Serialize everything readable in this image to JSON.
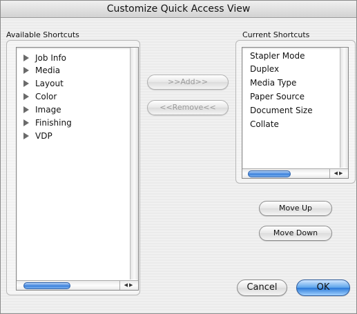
{
  "window": {
    "title": "Customize Quick Access View"
  },
  "available": {
    "label": "Available Shortcuts",
    "items": [
      "Job Info",
      "Media",
      "Layout",
      "Color",
      "Image",
      "Finishing",
      "VDP"
    ]
  },
  "current": {
    "label": "Current Shortcuts",
    "items": [
      "Stapler Mode",
      "Duplex",
      "Media Type",
      "Paper Source",
      "Document Size",
      "Collate"
    ]
  },
  "buttons": {
    "add": ">>Add>>",
    "remove": "<<Remove<<",
    "move_up": "Move Up",
    "move_down": "Move Down",
    "cancel": "Cancel",
    "ok": "OK"
  },
  "icons": {
    "expand": "disclosure-triangle-icon",
    "scroll_left": "scroll-left-arrow-icon",
    "scroll_right": "scroll-right-arrow-icon"
  }
}
